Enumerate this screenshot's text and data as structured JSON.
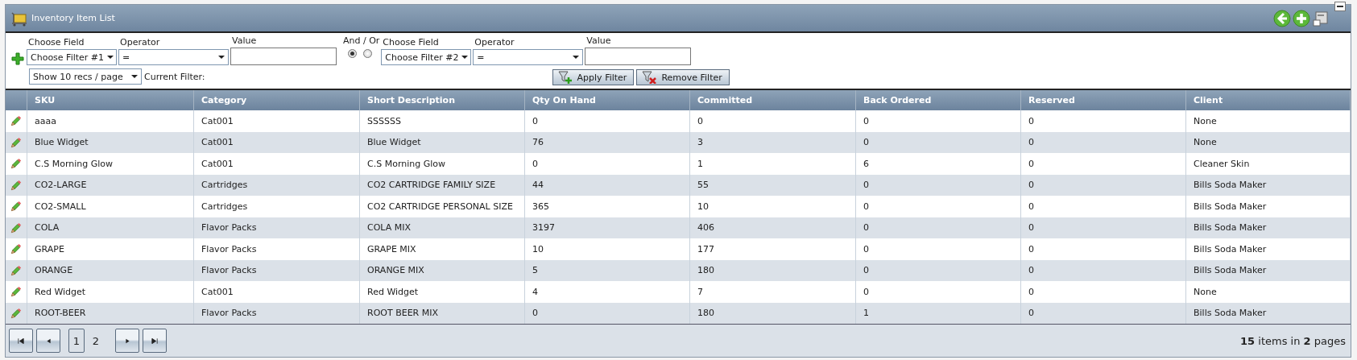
{
  "window": {
    "title": "Inventory Item List"
  },
  "filter": {
    "rows": [
      {
        "field_label": "Choose Field",
        "operator_label": "Operator",
        "value_label": "Value",
        "field": "Choose Filter #1",
        "operator": "="
      },
      {
        "field_label": "Choose Field",
        "operator_label": "Operator",
        "value_label": "Value",
        "field": "Choose Filter #2",
        "operator": "="
      }
    ],
    "and_or_label": "And / Or",
    "and_or": [
      {
        "selected": true
      },
      {
        "selected": false
      }
    ],
    "page_size": "Show 10 recs / page",
    "current_filter_label": "Current Filter:",
    "buttons": [
      {
        "kind": "apply",
        "label": "Apply Filter"
      },
      {
        "kind": "remove",
        "label": "Remove Filter"
      }
    ]
  },
  "table": {
    "columns": [
      "SKU",
      "Category",
      "Short Description",
      "Qty On Hand",
      "Committed",
      "Back Ordered",
      "Reserved",
      "Client"
    ],
    "rows": [
      [
        "aaaa",
        "Cat001",
        "SSSSSS",
        "0",
        "0",
        "0",
        "0",
        "None"
      ],
      [
        "Blue Widget",
        "Cat001",
        "Blue Widget",
        "76",
        "3",
        "0",
        "0",
        "None"
      ],
      [
        "C.S Morning Glow",
        "Cat001",
        "C.S Morning Glow",
        "0",
        "1",
        "6",
        "0",
        "Cleaner Skin"
      ],
      [
        "CO2-LARGE",
        "Cartridges",
        "CO2 CARTRIDGE FAMILY SIZE",
        "44",
        "55",
        "0",
        "0",
        "Bills Soda Maker"
      ],
      [
        "CO2-SMALL",
        "Cartridges",
        "CO2 CARTRIDGE PERSONAL SIZE",
        "365",
        "10",
        "0",
        "0",
        "Bills Soda Maker"
      ],
      [
        "COLA",
        "Flavor Packs",
        "COLA MIX",
        "3197",
        "406",
        "0",
        "0",
        "Bills Soda Maker"
      ],
      [
        "GRAPE",
        "Flavor Packs",
        "GRAPE MIX",
        "10",
        "177",
        "0",
        "0",
        "Bills Soda Maker"
      ],
      [
        "ORANGE",
        "Flavor Packs",
        "ORANGE MIX",
        "5",
        "180",
        "0",
        "0",
        "Bills Soda Maker"
      ],
      [
        "Red Widget",
        "Cat001",
        "Red Widget",
        "4",
        "7",
        "0",
        "0",
        "None"
      ],
      [
        "ROOT-BEER",
        "Flavor Packs",
        "ROOT BEER MIX",
        "0",
        "180",
        "1",
        "0",
        "Bills Soda Maker"
      ]
    ]
  },
  "pager": {
    "pages": [
      {
        "label": "1",
        "selected": true
      },
      {
        "label": "2",
        "selected": false
      }
    ],
    "summary": "**15** items in **2** pages"
  }
}
